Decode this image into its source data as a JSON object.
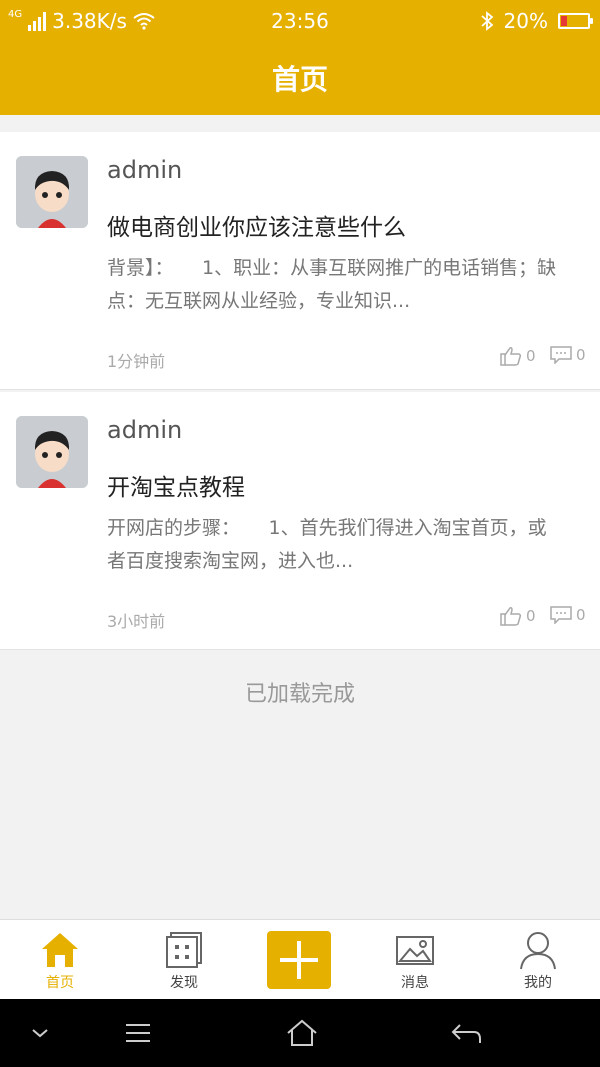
{
  "status_bar": {
    "network": "4G",
    "speed": "3.38K/s",
    "time": "23:56",
    "battery": "20%",
    "battery_level": 0.2
  },
  "header": {
    "title": "首页"
  },
  "posts": [
    {
      "username": "admin",
      "title": "做电商创业你应该注意些什么",
      "excerpt": "背景】：　　1、职业：从事互联网推广的电话销售；缺点：无互联网从业经验，专业知识...",
      "time": "1分钟前",
      "likes": "0",
      "comments": "0"
    },
    {
      "username": "admin",
      "title": "开淘宝点教程",
      "excerpt": "开网店的步骤：　　1、首先我们得进入淘宝首页，或者百度搜索淘宝网，进入也...",
      "time": "3小时前",
      "likes": "0",
      "comments": "0"
    }
  ],
  "list_status": "已加载完成",
  "tabs": [
    {
      "label": "首页",
      "icon": "home-icon",
      "active": true
    },
    {
      "label": "发现",
      "icon": "discover-icon"
    },
    {
      "label": "",
      "icon": "plus-icon"
    },
    {
      "label": "消息",
      "icon": "image-icon"
    },
    {
      "label": "我的",
      "icon": "person-icon"
    }
  ],
  "colors": {
    "accent": "#e6b000",
    "battery_low": "#e53935"
  }
}
